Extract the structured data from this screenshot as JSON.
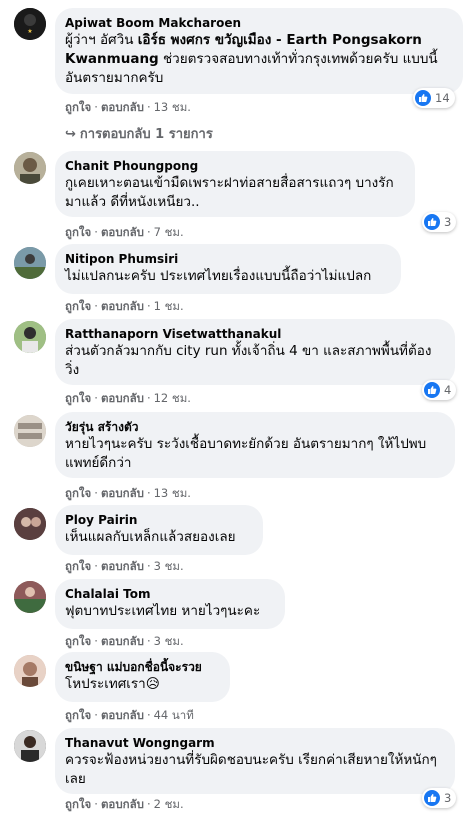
{
  "comments": [
    {
      "author": "Apiwat Boom Makcharoen",
      "text_pre": "ผู้ว่าฯ อัศวิน ",
      "text_tag": "เอิร์ธ พงศกร ขวัญเมือง - Earth Pongsakorn Kwanmuang",
      "text_post": " ช่วยตรวจสอบทางเท้าทั่วกรุงเทพด้วยครับ แบบนี้อันตรายมากครับ",
      "like": "ถูกใจ",
      "reply": "ตอบกลับ",
      "time": "13 ชม.",
      "reactions": "14",
      "replies_label": "การตอบกลับ 1 รายการ",
      "avatar_color": "#1a1a1a"
    },
    {
      "author": "Chanit Phoungpong",
      "text": "กูเคยเหาะตอนเข้ามืดเพราะฝาท่อสายสื่อสารแถวๆ บางรักมาแล้ว ดีที่หนังเหนียว..",
      "like": "ถูกใจ",
      "reply": "ตอบกลับ",
      "time": "7 ชม.",
      "reactions": "3",
      "avatar_color": "#8a8a72"
    },
    {
      "author": "Nitipon Phumsiri",
      "text": "ไม่แปลกนะครับ ประเทศไทยเรื่องแบบนี้ถือว่าไม่แปลก",
      "like": "ถูกใจ",
      "reply": "ตอบกลับ",
      "time": "1 ชม.",
      "avatar_color": "#5c7a8c"
    },
    {
      "author": "Ratthanaporn Visetwatthanakul",
      "text": "ส่วนตัวกลัวมากกับ city run ทั้งเจ้าถิ่น 4 ขา และสภาพพื้นที่ต้องวิ่ง",
      "like": "ถูกใจ",
      "reply": "ตอบกลับ",
      "time": "12 ชม.",
      "reactions": "4",
      "avatar_color": "#6f8f5e"
    },
    {
      "author": "วัยรุ่น สร้างตัว",
      "text": "หายไวๆนะครับ ระวังเชื้อบาดทะยักด้วย อันตรายมากๆ ให้ไปพบแพทย์ดีกว่า",
      "like": "ถูกใจ",
      "reply": "ตอบกลับ",
      "time": "13 ชม.",
      "avatar_color": "#b8b0a6"
    },
    {
      "author": "Ploy Pairin",
      "text": "เห็นแผลกับเหล็กแล้วสยองเลย",
      "like": "ถูกใจ",
      "reply": "ตอบกลับ",
      "time": "3 ชม.",
      "avatar_color": "#3d2b2b"
    },
    {
      "author": "Chalalai Tom",
      "text": "ฟุตบาทประเทศไทย หายไวๆนะคะ",
      "like": "ถูกใจ",
      "reply": "ตอบกลับ",
      "time": "3 ชม.",
      "avatar_color": "#7a4848"
    },
    {
      "author": "ขนิษฐา แม่บอกชื่อนี้จะรวย",
      "text": "โหประเทศเรา",
      "emoji": "😥",
      "like": "ถูกใจ",
      "reply": "ตอบกลับ",
      "time": "44 นาที",
      "avatar_color": "#c9a99a"
    },
    {
      "author": "Thanavut Wongngarm",
      "text": "ควรจะฟ้องหน่วยงานที่รับผิดชอบนะครับ เรียกค่าเสียหายให้หนักๆเลย",
      "like": "ถูกใจ",
      "reply": "ตอบกลับ",
      "time": "2 ชม.",
      "reactions": "3",
      "avatar_color": "#4a4a4a"
    }
  ],
  "separator": "·"
}
